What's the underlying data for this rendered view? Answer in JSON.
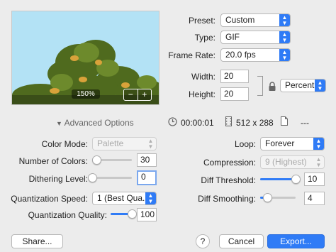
{
  "preview": {
    "zoom_label": "150%",
    "zoom_out_symbol": "−",
    "zoom_in_symbol": "+"
  },
  "right_panel": {
    "preset_label": "Preset:",
    "preset_value": "Custom",
    "type_label": "Type:",
    "type_value": "GIF",
    "frame_rate_label": "Frame Rate:",
    "frame_rate_value": "20.0 fps",
    "width_label": "Width:",
    "width_value": "20",
    "height_label": "Height:",
    "height_value": "20",
    "unit_value": "Percent"
  },
  "info_bar": {
    "advanced_options_label": "Advanced Options",
    "duration": "00:00:01",
    "dimensions": "512 x 288",
    "file_size": "---"
  },
  "advanced": {
    "color_mode_label": "Color Mode:",
    "color_mode_value": "Palette",
    "num_colors_label": "Number of Colors:",
    "num_colors_value": "30",
    "num_colors_fraction": 0.12,
    "dithering_label": "Dithering Level:",
    "dithering_value": "0",
    "dithering_fraction": 0.0,
    "quant_speed_label": "Quantization Speed:",
    "quant_speed_value": "1 (Best Qua...",
    "quant_quality_label": "Quantization Quality:",
    "quant_quality_value": "100",
    "quant_quality_fraction": 1.0,
    "loop_label": "Loop:",
    "loop_value": "Forever",
    "compression_label": "Compression:",
    "compression_value": "9 (Highest)",
    "diff_threshold_label": "Diff Threshold:",
    "diff_threshold_value": "10",
    "diff_threshold_fraction": 1.0,
    "diff_smoothing_label": "Diff Smoothing:",
    "diff_smoothing_value": "4",
    "diff_smoothing_fraction": 0.2
  },
  "footer": {
    "share_label": "Share...",
    "help_label": "?",
    "cancel_label": "Cancel",
    "export_label": "Export..."
  },
  "colors": {
    "accent": "#2f7bf6",
    "window_bg": "#ececec"
  }
}
